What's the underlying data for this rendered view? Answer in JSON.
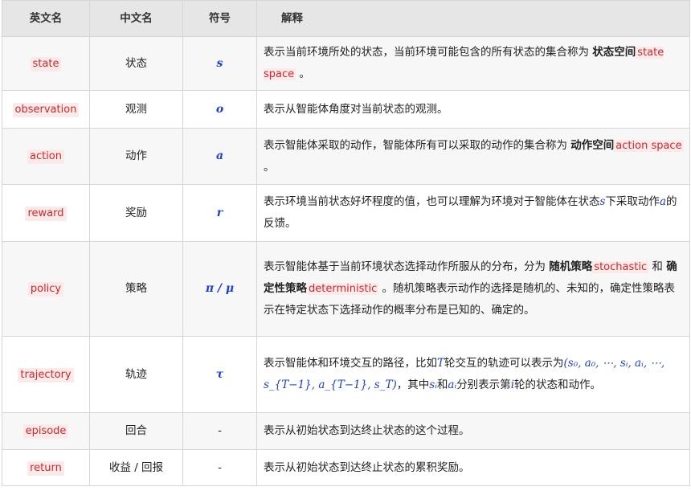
{
  "headers": {
    "en": "英文名",
    "zh": "中文名",
    "sym": "符号",
    "desc": "解释"
  },
  "rows": [
    {
      "en": "state",
      "zh": "状态",
      "sym": "s",
      "d": [
        "表示当前环境所处的状态，当前环境可能包含的所有状态的集合称为 ",
        "状态空间",
        "state space",
        " 。"
      ]
    },
    {
      "en": "observation",
      "zh": "观测",
      "sym": "o",
      "d": [
        "表示从智能体角度对当前状态的观测。"
      ]
    },
    {
      "en": "action",
      "zh": "动作",
      "sym": "a",
      "d": [
        "表示智能体采取的动作，智能体所有可以采取的动作的集合称为 ",
        "动作空间",
        "action space",
        " 。"
      ]
    },
    {
      "en": "reward",
      "zh": "奖励",
      "sym": "r",
      "d": [
        "表示环境当前状态好坏程度的值，也可以理解为环境对于智能体在状态",
        "s",
        "下采取动作",
        "a",
        "的反馈。"
      ]
    },
    {
      "en": "policy",
      "zh": "策略",
      "sym": "π / μ",
      "d": [
        "表示智能体基于当前环境状态选择动作所服从的分布，分为 ",
        "随机策略",
        "stochastic",
        " 和 ",
        "确定性策略",
        "deterministic",
        " 。随机策略表示动作的选择是随机的、未知的，确定性策略表示在特定状态下选择动作的概率分布是已知的、确定的。"
      ]
    },
    {
      "en": "trajectory",
      "zh": "轨迹",
      "sym": "τ",
      "d": [
        "表示智能体和环境交互的路径，比如",
        "T",
        "轮交互的轨迹可以表示为",
        "(s₀, a₀, ⋯, sᵢ, aᵢ, ⋯, s_{T−1}, a_{T−1}, s_T)",
        "，其中",
        "sᵢ",
        "和",
        "aᵢ",
        "分别表示第",
        "i",
        "轮的状态和动作。"
      ]
    },
    {
      "en": "episode",
      "zh": "回合",
      "sym": "-",
      "d": [
        "表示从初始状态到达终止状态的这个过程。"
      ]
    },
    {
      "en": "return",
      "zh": "收益 / 回报",
      "sym": "-",
      "d": [
        "表示从初始状态到达终止状态的累积奖励。"
      ]
    }
  ]
}
